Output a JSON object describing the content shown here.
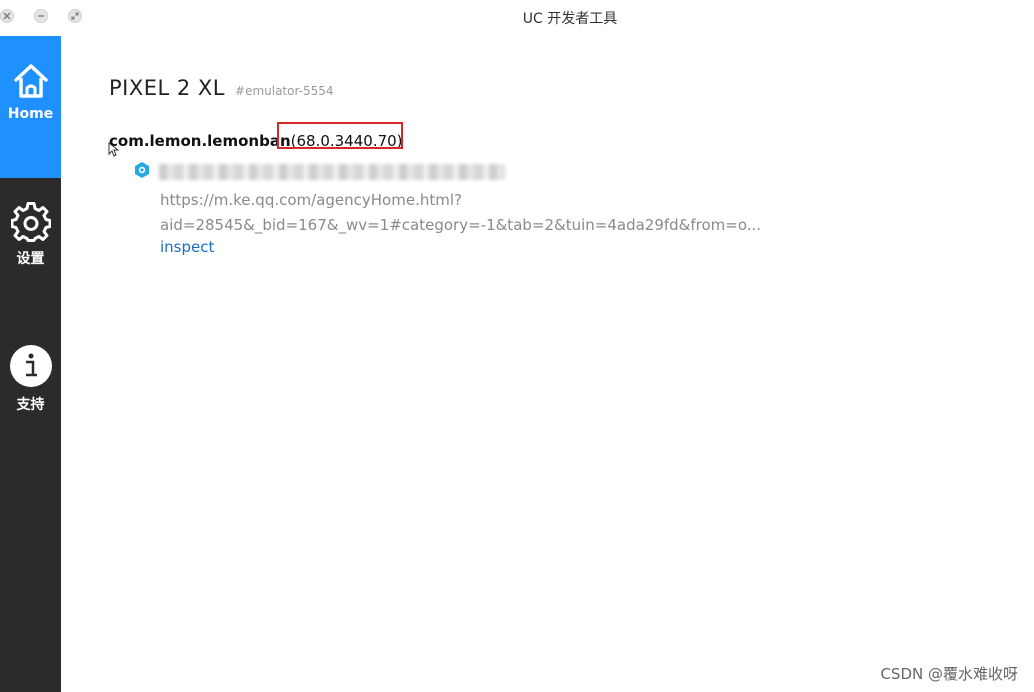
{
  "window": {
    "title": "UC 开发者工具"
  },
  "sidebar": {
    "items": [
      {
        "label": "Home",
        "icon": "home-icon",
        "active": true
      },
      {
        "label": "设置",
        "icon": "gear-icon",
        "active": false
      },
      {
        "label": "支持",
        "icon": "info-icon",
        "active": false
      }
    ]
  },
  "device": {
    "name": "PIXEL 2 XL",
    "serial": "#emulator-5554"
  },
  "app": {
    "package": "com.lemon.lemonban",
    "version": "(68.0.3440.70)"
  },
  "page": {
    "icon": "webview-icon",
    "url_line1": "https://m.ke.qq.com/agencyHome.html?",
    "url_line2": "aid=28545&_bid=167&_wv=1#category=-1&tab=2&tuin=4ada29fd&from=o...",
    "inspect_label": "inspect"
  },
  "watermark": "CSDN @覆水难收呀",
  "colors": {
    "sidebar_bg": "#2b2b2b",
    "active_nav": "#1e90ff",
    "highlight_box": "#d9262b",
    "link": "#1a6fc4"
  }
}
